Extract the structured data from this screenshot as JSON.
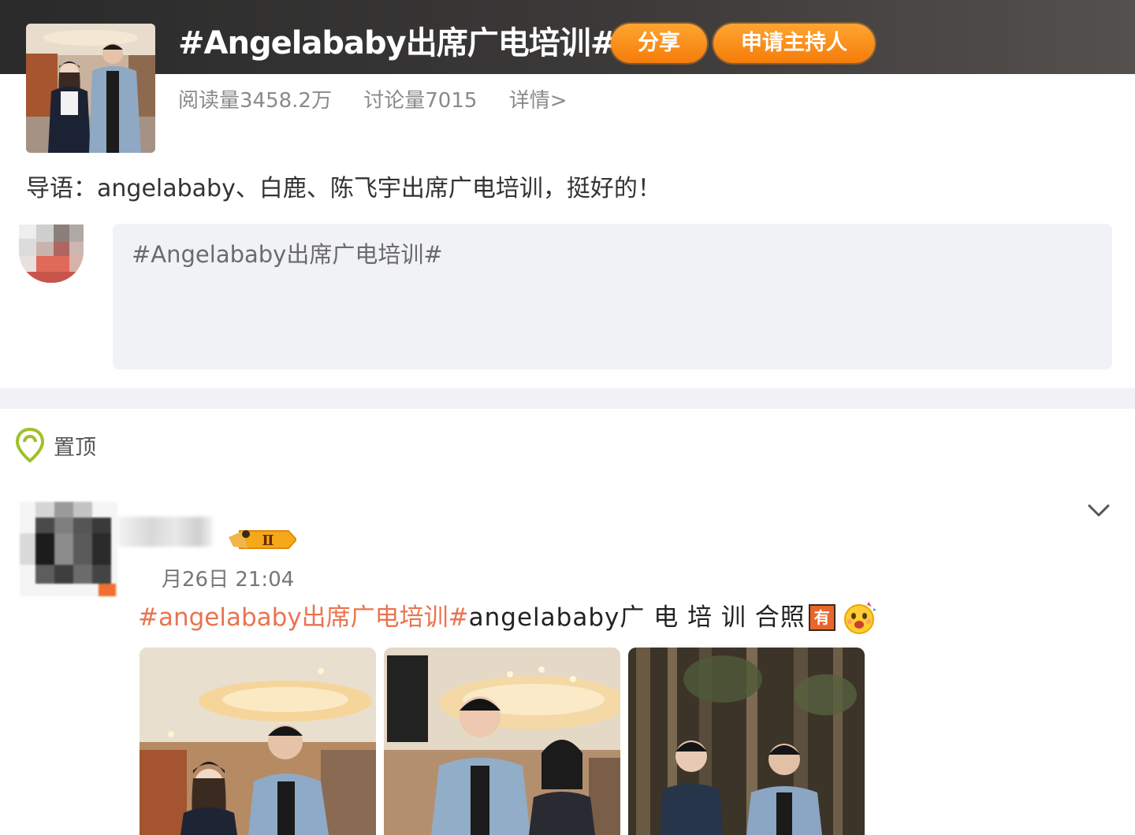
{
  "topic": {
    "title": "#Angelababy出席广电培训#",
    "share_label": "分享",
    "host_label": "申请主持人",
    "reads": "阅读量3458.2万",
    "discussions": "讨论量7015",
    "details": "详情>",
    "intro": "导语：angelababy、白鹿、陈飞宇出席广电培训，挺好的！"
  },
  "compose": {
    "placeholder": "#Angelababy出席广电培训#"
  },
  "pinned": {
    "label": "置顶"
  },
  "post": {
    "level_badge": "Ⅱ",
    "time": "月26日 21:04",
    "hashtag": "#angelababy出席广电培训#",
    "text": " angelababy广 电 培 训 合照",
    "you_badge": "有",
    "photo_count": 3
  },
  "icons": {
    "pin": "location-pin-icon",
    "expand": "chevron-down-icon",
    "emoji": "party-face-emoji-icon"
  },
  "colors": {
    "accent_orange": "#f57c0a",
    "hashtag": "#eb7350",
    "pin_green": "#9ec12a",
    "header_dark": "#2a2a2a"
  }
}
